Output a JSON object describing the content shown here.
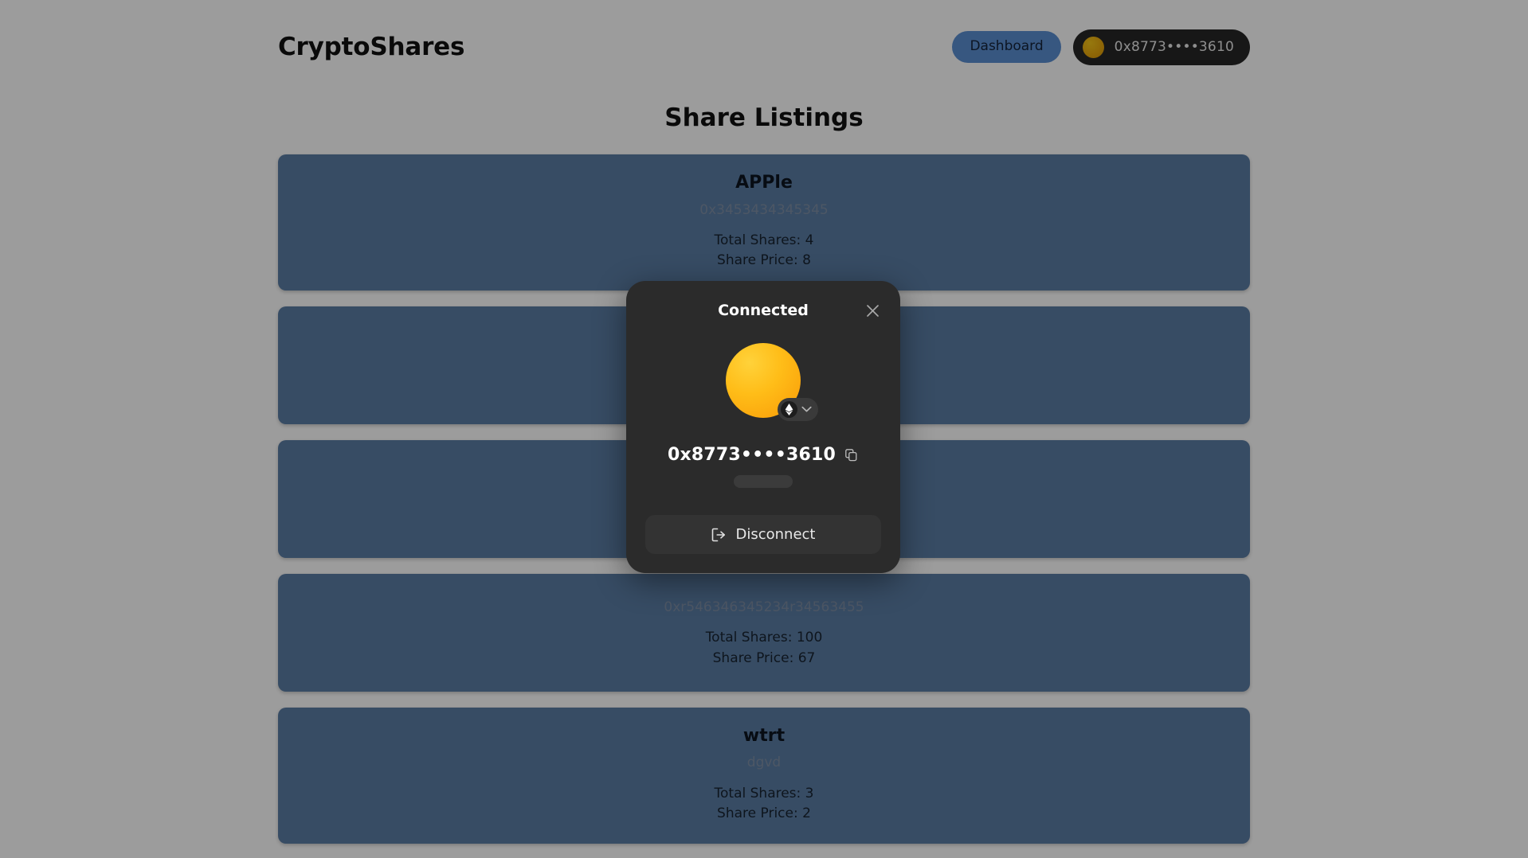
{
  "header": {
    "brand": "CryptoShares",
    "dashboard_label": "Dashboard",
    "wallet_address": "0x8773••••3610",
    "wallet_avatar_icon": "wallet-avatar-icon"
  },
  "main": {
    "page_title": "Share Listings",
    "listings": [
      {
        "name": "APPle",
        "address": "0x3453434345345",
        "total_shares": "Total Shares: 4",
        "share_price": "Share Price: 8"
      },
      {
        "name": "",
        "address": "",
        "total_shares": "",
        "share_price": ""
      },
      {
        "name": "",
        "address": "",
        "total_shares": "",
        "share_price": ""
      },
      {
        "name": "",
        "address": "0xr546346345234r34563455",
        "total_shares": "Total Shares: 100",
        "share_price": "Share Price: 67"
      },
      {
        "name": "wtrt",
        "address": "dgvd",
        "total_shares": "Total Shares: 3",
        "share_price": "Share Price: 2"
      }
    ]
  },
  "modal": {
    "title": "Connected",
    "close_icon": "close-icon",
    "avatar_icon": "wallet-avatar-large-icon",
    "chain_icon": "ethereum-icon",
    "chain_chevron_icon": "chevron-down-icon",
    "address": "0x8773••••3610",
    "copy_icon": "copy-icon",
    "balance_placeholder": "",
    "disconnect_label": "Disconnect",
    "disconnect_icon": "logout-icon"
  },
  "colors": {
    "card_blue": "#5a7ca4",
    "accent_blue": "#5b8ed1",
    "modal_bg": "#2b2b2b",
    "avatar_orange": "#ffbd18",
    "page_bg": "#ffffff",
    "overlay": "rgba(0,0,0,0.39)"
  }
}
